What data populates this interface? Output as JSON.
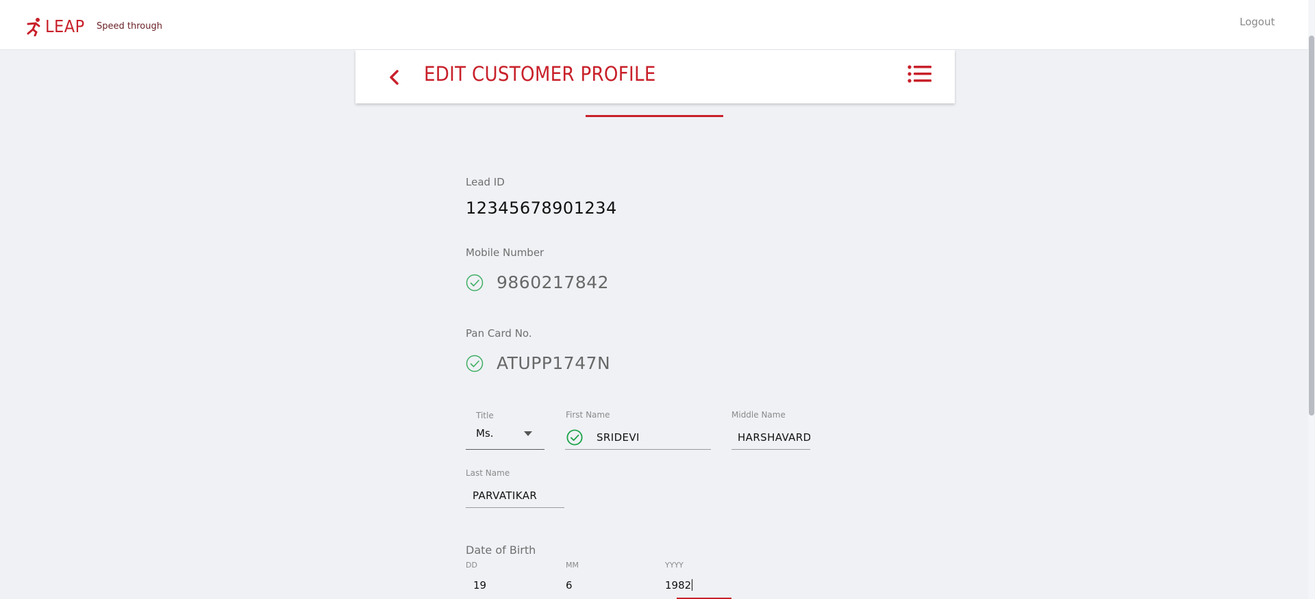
{
  "header": {
    "brand": "LEAP",
    "tagline": "Speed through",
    "logout_label": "Logout"
  },
  "page": {
    "title": "EDIT CUSTOMER PROFILE",
    "back_icon": "chevron-left-icon",
    "menu_icon": "list-menu-icon"
  },
  "colors": {
    "brand": "#c8202a",
    "verified": "#1ea34a",
    "background": "#eff1f5"
  },
  "profile": {
    "lead_id_label": "Lead ID",
    "lead_id_value": "12345678901234",
    "mobile_label": "Mobile Number",
    "mobile_value": "9860217842",
    "pan_label": "Pan Card No.",
    "pan_value": "ATUPP1747N"
  },
  "name": {
    "title_label": "Title",
    "title_value": "Ms.",
    "first_name_label": "First Name",
    "first_name_value": "SRIDEVI",
    "middle_name_label": "Middle Name",
    "middle_name_value": "HARSHAVARDH",
    "last_name_label": "Last Name",
    "last_name_value": "PARVATIKAR"
  },
  "dob": {
    "title": "Date of Birth",
    "dd_label": "DD",
    "dd_value": "19",
    "mm_label": "MM",
    "mm_value": "6",
    "yyyy_label": "YYYY",
    "yyyy_value": "1982"
  }
}
